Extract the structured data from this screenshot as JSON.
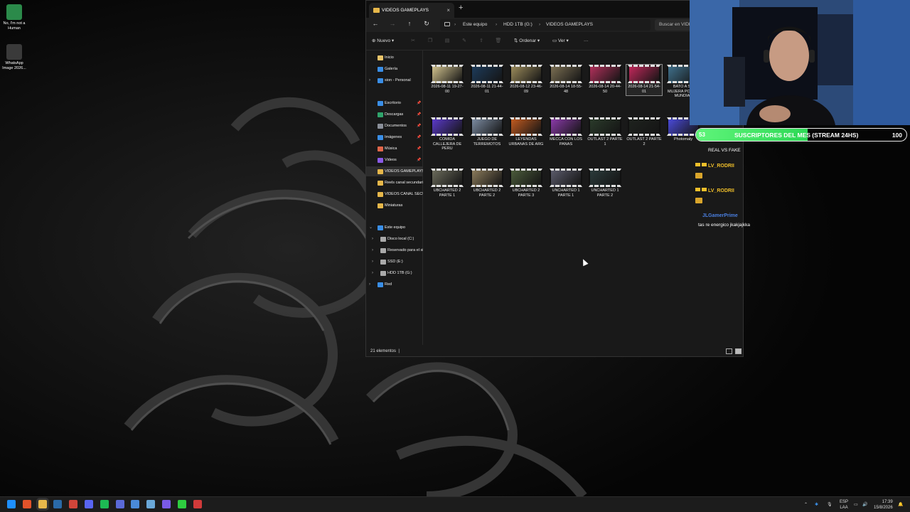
{
  "desktop": {
    "icons": [
      {
        "label": "No, I'm not a Human",
        "icon": "game-app-icon",
        "color": "#2b8a4a"
      },
      {
        "label": "WhatsApp Image 2026...",
        "icon": "image-file-icon",
        "color": "#555555"
      }
    ]
  },
  "explorer": {
    "tab_title": "VIDEOS GAMEPLAYS",
    "tab_close": "×",
    "new_tab": "+",
    "nav": {
      "back": "←",
      "forward": "→",
      "up": "↑",
      "refresh": "↻"
    },
    "breadcrumb": [
      "Este equipo",
      "HDD 1TB (G:)",
      "VIDEOS GAMEPLAYS"
    ],
    "breadcrumb_sep": "›",
    "search_placeholder": "Buscar en VIDEOS GAMEPLAYS",
    "toolbar": {
      "new_label": "Nuevo",
      "sort_label": "Ordenar",
      "view_label": "Ver",
      "more": "···"
    },
    "sidebar": {
      "top": [
        {
          "label": "Inicio",
          "icon": "home-icon",
          "color": "#e9c46a"
        },
        {
          "label": "Galería",
          "icon": "gallery-icon",
          "color": "#3a8ee6"
        },
        {
          "label": "sion - Personal",
          "icon": "cloud-icon",
          "color": "#3a8ee6",
          "expandable": true
        }
      ],
      "quick": [
        {
          "label": "Escritorio",
          "icon": "desktop-icon",
          "color": "#3a8ee6",
          "pinned": true
        },
        {
          "label": "Descargas",
          "icon": "download-icon",
          "color": "#2fa36b",
          "pinned": true
        },
        {
          "label": "Documentos",
          "icon": "documents-icon",
          "color": "#8a8f99",
          "pinned": true
        },
        {
          "label": "Imágenes",
          "icon": "pictures-icon",
          "color": "#3a8ee6",
          "pinned": true
        },
        {
          "label": "Música",
          "icon": "music-icon",
          "color": "#e0664a",
          "pinned": true
        },
        {
          "label": "Videos",
          "icon": "videos-icon",
          "color": "#8a5ae6",
          "pinned": true
        },
        {
          "label": "VIDEOS GAMEPLAYS",
          "icon": "folder-icon",
          "color": "#e6b74a",
          "selected": true
        },
        {
          "label": "Reels canal secundario",
          "icon": "folder-icon",
          "color": "#e6b74a"
        },
        {
          "label": "VIDEOS CANAL SECUNDARIO",
          "icon": "folder-icon",
          "color": "#e6b74a"
        },
        {
          "label": "Miniaturas",
          "icon": "folder-icon",
          "color": "#e6b74a"
        }
      ],
      "pc": [
        {
          "label": "Este equipo",
          "icon": "computer-icon",
          "color": "#3a8ee6",
          "expanded": true
        },
        {
          "label": "Disco local (C:)",
          "icon": "drive-icon",
          "color": "#aaaaaa"
        },
        {
          "label": "Reservado para el sistema",
          "icon": "drive-icon",
          "color": "#aaaaaa"
        },
        {
          "label": "SSD (E:)",
          "icon": "drive-icon",
          "color": "#aaaaaa"
        },
        {
          "label": "HDD 1TB (G:)",
          "icon": "drive-icon",
          "color": "#aaaaaa"
        },
        {
          "label": "Red",
          "icon": "network-icon",
          "color": "#3a8ee6"
        }
      ]
    },
    "files": [
      {
        "name": "2026-08-11 19-27-00",
        "thumb": "#cfc08c"
      },
      {
        "name": "2026-08-11 21-44-01",
        "thumb": "#1d3b5a"
      },
      {
        "name": "2026-08-12 23-46-09",
        "thumb": "#9a8a5a"
      },
      {
        "name": "2026-08-14 18-55-48",
        "thumb": "#7a6e52"
      },
      {
        "name": "2026-08-14 20-44-50",
        "thumb": "#b0305a"
      },
      {
        "name": "2026-08-14 21-54-01",
        "thumb": "#c0285a",
        "selected": true
      },
      {
        "name": "BATO A SU MUJERA POR EL MUNDIAL",
        "thumb": "#3f6f8a"
      },
      {
        "name": "COMIDA CALLEJERA DE PERU",
        "thumb": "#5a3ac8"
      },
      {
        "name": "JUEGO DE TERREMOTOS",
        "thumb": "#7a8aa0"
      },
      {
        "name": "LEYENDAS URBANAS DE ARG",
        "thumb": "#c05a20"
      },
      {
        "name": "MECCA CON LOS PANAS",
        "thumb": "#8a3aa8"
      },
      {
        "name": "OUTLAST 2 PARTE 1",
        "thumb": "#2a3a2a"
      },
      {
        "name": "OUTLAST 2 PARTE 2",
        "thumb": "#1e221e"
      },
      {
        "name": "Photomaly",
        "thumb": "#4a4ad8"
      },
      {
        "name": "UBCHARTED 2 PARTE 1",
        "thumb": "#6a6a5a"
      },
      {
        "name": "UBCHARTED 2 PARTE 2",
        "thumb": "#8a7a5a"
      },
      {
        "name": "UBCHARTED 2 PARTE 3",
        "thumb": "#4a5a3a"
      },
      {
        "name": "UNCHARTED 1 PARTE 1",
        "thumb": "#5a5a6a"
      },
      {
        "name": "UNCHARTED 1 PARTE 2",
        "thumb": "#2a3a3a"
      }
    ],
    "status": {
      "count": "21 elementos",
      "cursor": "|"
    }
  },
  "stream_overlay": {
    "sub_goal": {
      "current": "53",
      "label": "SUSCRIPTORES DEL MES (STREAM 24HS)",
      "target": "100",
      "progress": 0.53,
      "color": "#2ed856"
    },
    "chat": [
      {
        "user": "",
        "text": "REAL VS FAKE"
      },
      {
        "user": "LV_RODRII",
        "emote": true,
        "color": "#f0bf2a"
      },
      {
        "user": "LV_RODRII",
        "emote": true,
        "color": "#f0bf2a"
      },
      {
        "user": "JLGamerPrime",
        "text": "tas re energico jkakjajkka",
        "color": "#4a7fe0"
      }
    ]
  },
  "taskbar": {
    "apps": [
      {
        "name": "windows-start-icon",
        "color": "#1e90ff"
      },
      {
        "name": "brave-icon",
        "color": "#e0522a"
      },
      {
        "name": "file-explorer-icon",
        "color": "#e6b74a",
        "active": true
      },
      {
        "name": "steam-icon",
        "color": "#2a6aa8"
      },
      {
        "name": "chrome-icon",
        "color": "#d0453a"
      },
      {
        "name": "discord-icon",
        "color": "#5865f2"
      },
      {
        "name": "spotify-icon",
        "color": "#1db954"
      },
      {
        "name": "app-window-icon",
        "color": "#5a6ad8"
      },
      {
        "name": "app-tray-icon",
        "color": "#4a8ad8"
      },
      {
        "name": "sketch-app-icon",
        "color": "#6aa8d8"
      },
      {
        "name": "twitch-icon",
        "color": "#7a5ae6"
      },
      {
        "name": "game-app-icon",
        "color": "#2ecc40"
      },
      {
        "name": "recorder-icon",
        "color": "#d03a3a"
      }
    ],
    "tray": {
      "lang": "ESP",
      "lang_sub": "LAA",
      "time": "17:39",
      "date": "15/8/2026"
    }
  }
}
